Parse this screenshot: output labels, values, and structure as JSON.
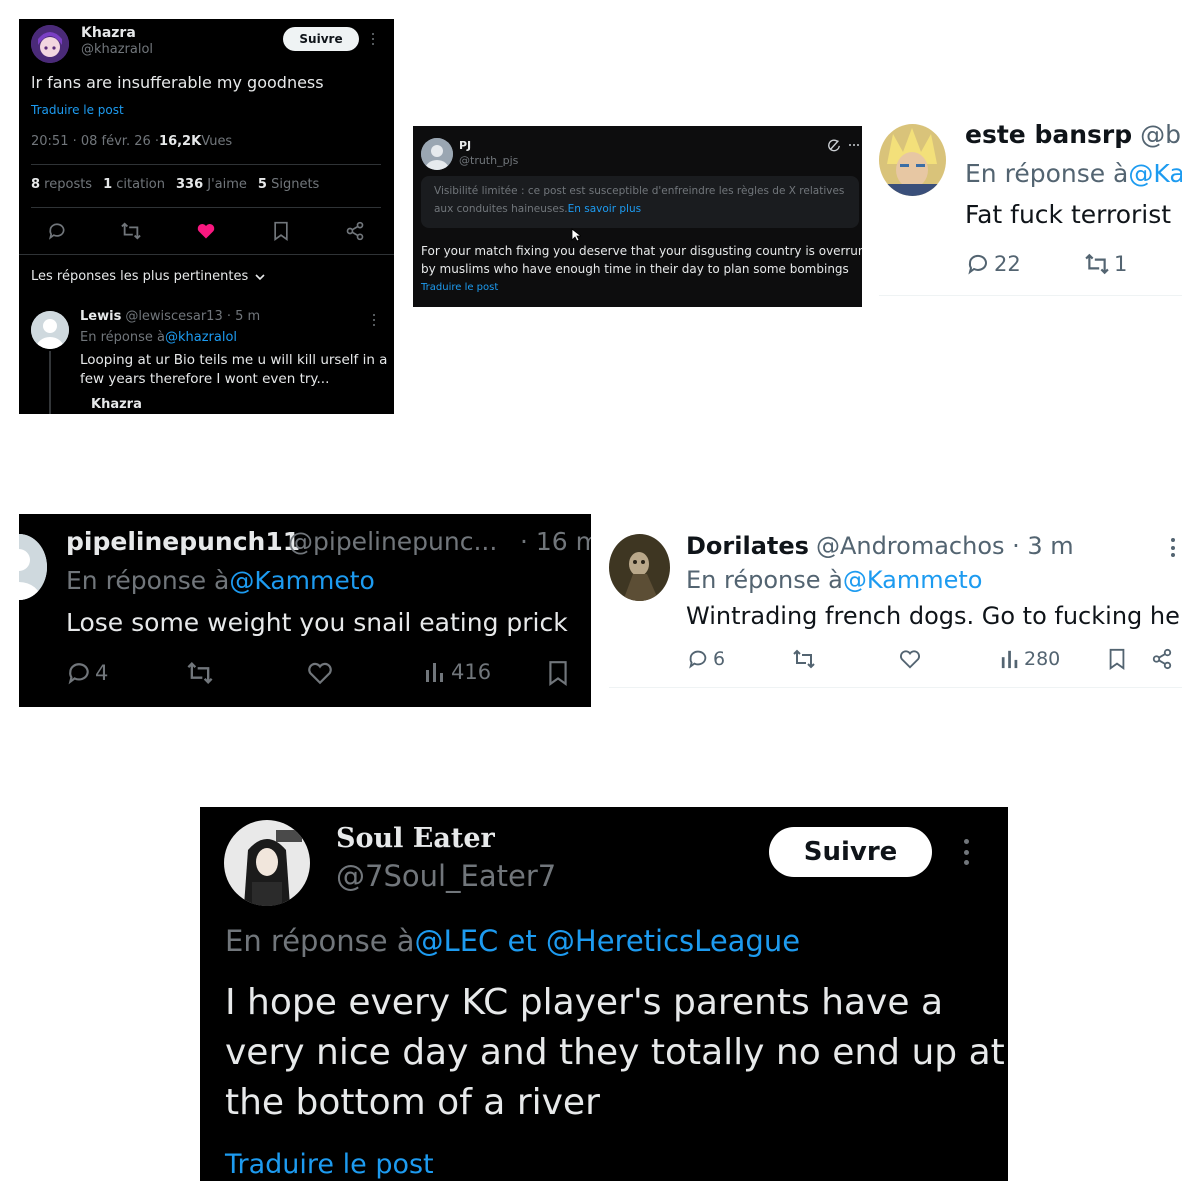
{
  "p1": {
    "display_name": "Khazra",
    "handle": "@khazralol",
    "follow_label": "Suivre",
    "text": "lr fans are insufferable my goodness",
    "translate": "Traduire le post",
    "meta_time": "20:51 · 08 févr. 26 · ",
    "meta_views_count": "16,2K",
    "meta_views_label": " Vues",
    "stats": [
      {
        "n": "8",
        "l": " reposts"
      },
      {
        "n": "1",
        "l": " citation"
      },
      {
        "n": "336",
        "l": " J'aime"
      },
      {
        "n": "5",
        "l": " Signets"
      }
    ],
    "replies_header": "Les réponses les plus pertinentes",
    "reply": {
      "name": "Lewis",
      "handle": "@lewiscesar13 · 5 m",
      "in_reply_prefix": "En réponse à ",
      "in_reply_to": "@khazralol",
      "text_line1": "Looping at ur Bio teils me u will kill urself in a",
      "text_line2": "few years therefore I wont even try...",
      "next_name": "Khazra"
    },
    "like_color": "#f91880"
  },
  "p2": {
    "name": "PJ",
    "handle": "@truth_pjs",
    "notice_line1": "Visibilité limitée : ce post est susceptible d'enfreindre les règles de X relatives",
    "notice_line2_prefix": "aux conduites haineuses. ",
    "notice_link": "En savoir plus",
    "text_line1": "For your match fixing you deserve that your disgusting country is overrun",
    "text_line2": "by muslims who have enough time in their day to plan some bombings",
    "translate": "Traduire le post"
  },
  "p3": {
    "name": "este bansrp",
    "handle": "@ba",
    "in_reply_prefix": "En réponse à ",
    "in_reply_to": "@Ka",
    "text": "Fat fuck terrorist",
    "replies": "22",
    "reposts": "1"
  },
  "p4": {
    "name": "pipelinepunch11",
    "handle": "@pipelinepunc...",
    "time": "· 16 m",
    "in_reply_prefix": "En réponse à ",
    "in_reply_to": "@Kammeto",
    "text": "Lose some weight you snail eating prick",
    "replies": "4",
    "views": "416"
  },
  "p5": {
    "name": "Dorilates",
    "handle": "@Andromachos · 3 m",
    "in_reply_prefix": "En réponse à ",
    "in_reply_to": "@Kammeto",
    "text": "Wintrading french dogs. Go to fucking hell",
    "replies": "6",
    "views": "280"
  },
  "p6": {
    "name": "Soul Eater",
    "handle": "@7Soul_Eater7",
    "follow_label": "Suivre",
    "in_reply_prefix": "En réponse à ",
    "in_reply_to": "@LEC et @HereticsLeague",
    "text_line1": "I hope every KC player's parents have a",
    "text_line2": "very nice day and they totally no end up at",
    "text_line3": "the bottom of a river",
    "translate": "Traduire le post"
  }
}
